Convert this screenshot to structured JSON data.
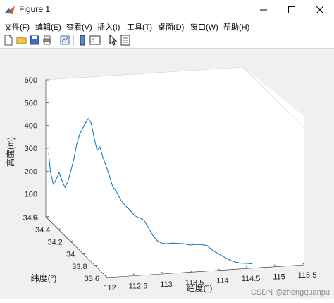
{
  "window": {
    "title": "Figure 1"
  },
  "menu": {
    "items": [
      {
        "label": "文件(F)"
      },
      {
        "label": "编辑(E)"
      },
      {
        "label": "查看(V)"
      },
      {
        "label": "插入(I)"
      },
      {
        "label": "工具(T)"
      },
      {
        "label": "桌面(D)"
      },
      {
        "label": "窗口(W)"
      },
      {
        "label": "帮助(H)"
      }
    ]
  },
  "toolbar": {
    "buttons": [
      "new-figure-icon",
      "open-file-icon",
      "save-icon",
      "print-icon",
      "link-plot-icon",
      "insert-colorbar-icon",
      "insert-legend-icon",
      "edit-plot-icon",
      "property-inspector-icon"
    ]
  },
  "chart_data": {
    "type": "line",
    "view": "3d",
    "xlabel": "经度(°)",
    "ylabel": "纬度(°)",
    "zlabel": "高度(m)",
    "xlim": [
      112,
      115.5
    ],
    "ylim": [
      33.6,
      34.6
    ],
    "zlim": [
      0,
      600
    ],
    "x_ticks": [
      "112",
      "112.5",
      "113",
      "113.5",
      "114",
      "114.5",
      "115",
      "115.5"
    ],
    "y_ticks": [
      "33.6",
      "33.8",
      "34",
      "34.2",
      "34.4",
      "34.6"
    ],
    "z_ticks": [
      "0",
      "100",
      "200",
      "300",
      "400",
      "500",
      "600"
    ],
    "line_color": "#0072BD",
    "grid": false,
    "series": [
      {
        "points": [
          [
            112.05,
            34.6,
            280
          ],
          [
            112.07,
            34.59,
            200
          ],
          [
            112.1,
            34.57,
            150
          ],
          [
            112.13,
            34.55,
            175
          ],
          [
            112.16,
            34.53,
            210
          ],
          [
            112.19,
            34.51,
            180
          ],
          [
            112.22,
            34.49,
            155
          ],
          [
            112.25,
            34.47,
            185
          ],
          [
            112.28,
            34.45,
            235
          ],
          [
            112.31,
            34.43,
            290
          ],
          [
            112.34,
            34.41,
            360
          ],
          [
            112.37,
            34.39,
            410
          ],
          [
            112.4,
            34.37,
            440
          ],
          [
            112.43,
            34.35,
            470
          ],
          [
            112.46,
            34.33,
            495
          ],
          [
            112.49,
            34.31,
            480
          ],
          [
            112.52,
            34.29,
            420
          ],
          [
            112.55,
            34.27,
            370
          ],
          [
            112.58,
            34.25,
            390
          ],
          [
            112.61,
            34.23,
            350
          ],
          [
            112.64,
            34.21,
            320
          ],
          [
            112.68,
            34.19,
            280
          ],
          [
            112.72,
            34.17,
            235
          ],
          [
            112.77,
            34.15,
            215
          ],
          [
            112.82,
            34.13,
            185
          ],
          [
            112.88,
            34.11,
            165
          ],
          [
            112.94,
            34.09,
            150
          ],
          [
            113.0,
            34.07,
            130
          ],
          [
            113.06,
            34.05,
            125
          ],
          [
            113.12,
            34.03,
            120
          ],
          [
            113.18,
            34.01,
            90
          ],
          [
            113.24,
            33.99,
            60
          ],
          [
            113.3,
            33.97,
            40
          ],
          [
            113.36,
            33.95,
            35
          ],
          [
            113.42,
            33.93,
            38
          ],
          [
            113.5,
            33.91,
            45
          ],
          [
            113.58,
            33.89,
            47
          ],
          [
            113.66,
            33.87,
            50
          ],
          [
            113.74,
            33.85,
            48
          ],
          [
            113.82,
            33.83,
            55
          ],
          [
            113.9,
            33.81,
            58
          ],
          [
            113.98,
            33.79,
            58
          ],
          [
            114.06,
            33.77,
            40
          ],
          [
            114.14,
            33.75,
            30
          ],
          [
            114.22,
            33.73,
            20
          ],
          [
            114.3,
            33.71,
            10
          ],
          [
            114.38,
            33.69,
            5
          ],
          [
            114.46,
            33.67,
            5
          ],
          [
            114.55,
            33.65,
            8
          ],
          [
            114.62,
            33.64,
            7
          ]
        ]
      }
    ]
  },
  "watermark": "CSDN @zhengquanpu"
}
